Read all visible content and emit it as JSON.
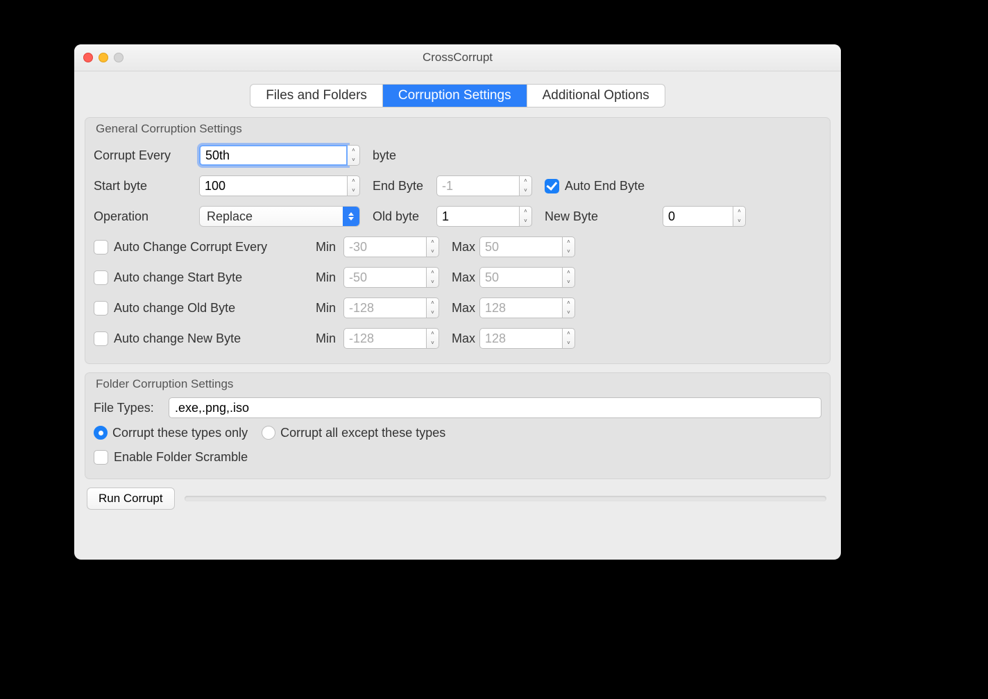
{
  "title": "CrossCorrupt",
  "tabs": [
    "Files and Folders",
    "Corruption Settings",
    "Additional Options"
  ],
  "active_tab": 1,
  "general": {
    "group_title": "General Corruption Settings",
    "corrupt_every_label": "Corrupt Every",
    "corrupt_every_value": "50th",
    "byte_label": "byte",
    "start_byte_label": "Start byte",
    "start_byte_value": "100",
    "end_byte_label": "End Byte",
    "end_byte_value": "-1",
    "auto_end_byte_label": "Auto End Byte",
    "auto_end_byte_checked": true,
    "operation_label": "Operation",
    "operation_value": "Replace",
    "old_byte_label": "Old byte",
    "old_byte_value": "1",
    "new_byte_label": "New Byte",
    "new_byte_value": "0",
    "auto_rows": [
      {
        "label": "Auto Change Corrupt Every",
        "min": "-30",
        "max": "50",
        "checked": false
      },
      {
        "label": "Auto change Start Byte",
        "min": "-50",
        "max": "50",
        "checked": false
      },
      {
        "label": "Auto change Old Byte",
        "min": "-128",
        "max": "128",
        "checked": false
      },
      {
        "label": "Auto change New Byte",
        "min": "-128",
        "max": "128",
        "checked": false
      }
    ],
    "min_label": "Min",
    "max_label": "Max"
  },
  "folder": {
    "group_title": "Folder Corruption Settings",
    "file_types_label": "File Types:",
    "file_types_value": ".exe,.png,.iso",
    "radio_only": "Corrupt these types only",
    "radio_except": "Corrupt all except these types",
    "radio_selection": "only",
    "enable_scramble_label": "Enable Folder Scramble",
    "enable_scramble_checked": false
  },
  "run_button": "Run Corrupt"
}
